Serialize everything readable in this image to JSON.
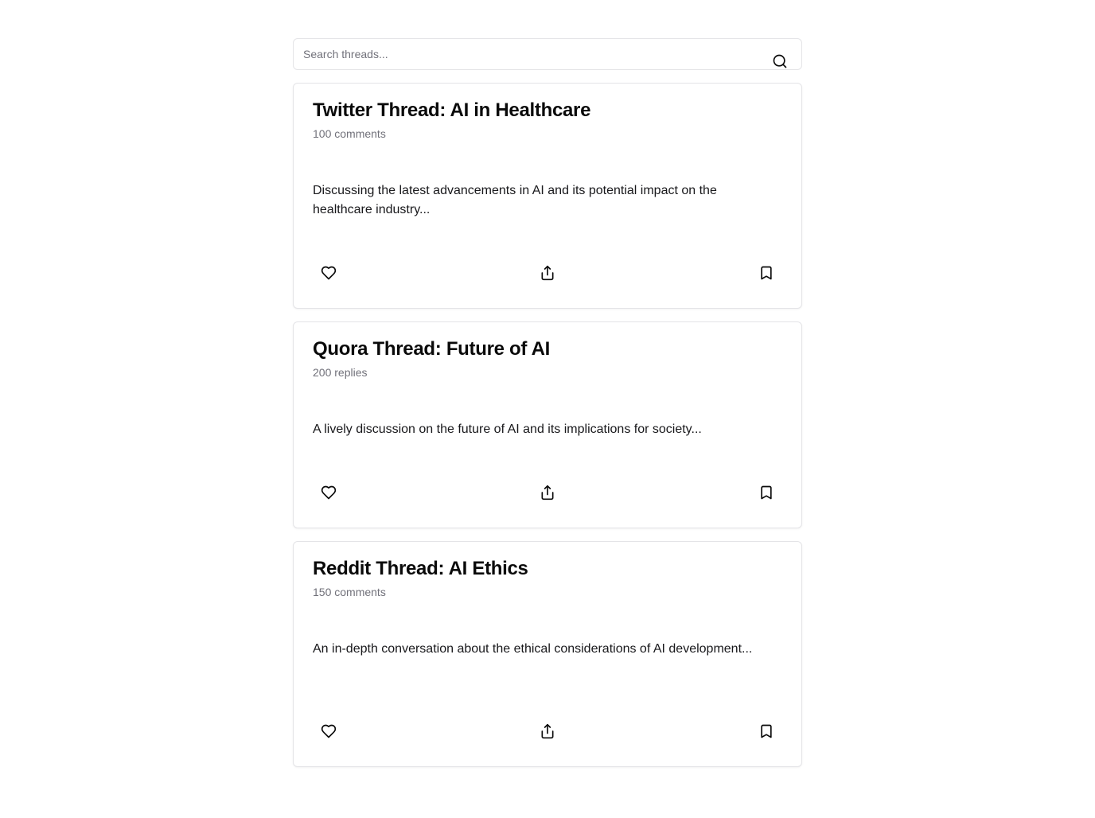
{
  "search": {
    "placeholder": "Search threads...",
    "value": "",
    "icon": "search-icon"
  },
  "threads": [
    {
      "title": "Twitter Thread: AI in Healthcare",
      "count": "100 comments",
      "excerpt": "Discussing the latest advancements in AI and its potential impact on the healthcare industry...",
      "actions": [
        "heart-icon",
        "share-icon",
        "bookmark-icon"
      ]
    },
    {
      "title": "Quora Thread: Future of AI",
      "count": "200 replies",
      "excerpt": "A lively discussion on the future of AI and its implications for society...",
      "actions": [
        "heart-icon",
        "share-icon",
        "bookmark-icon"
      ]
    },
    {
      "title": "Reddit Thread: AI Ethics",
      "count": "150 comments",
      "excerpt": "An in-depth conversation about the ethical considerations of AI development...",
      "actions": [
        "heart-icon",
        "share-icon",
        "bookmark-icon"
      ]
    }
  ],
  "colors": {
    "border": "#e4e4e7",
    "muted_text": "#71717a",
    "text": "#0a0a0a"
  }
}
